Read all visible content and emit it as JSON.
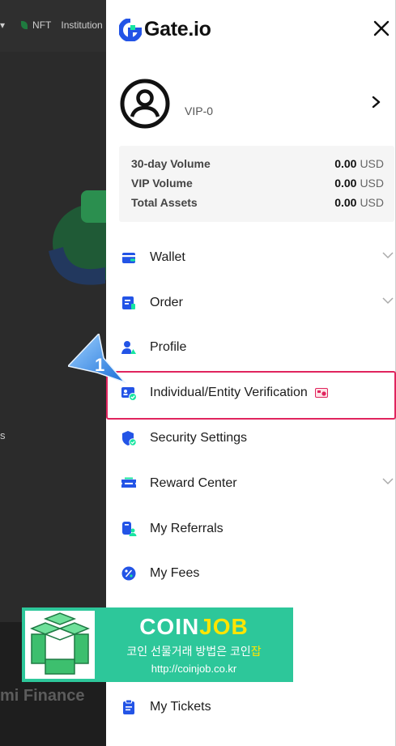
{
  "background_page": {
    "nav_arrow": "▾",
    "nav_nft": "NFT",
    "nav_institution": "Institution",
    "side_text": "s",
    "bottom_text": "mi Finance"
  },
  "header": {
    "brand": "Gate.io",
    "close_icon": "close-icon"
  },
  "profile": {
    "vip_label": "VIP-0"
  },
  "stats": [
    {
      "label": "30-day Volume",
      "value": "0.00",
      "unit": "USD"
    },
    {
      "label": "VIP Volume",
      "value": "0.00",
      "unit": "USD"
    },
    {
      "label": "Total Assets",
      "value": "0.00",
      "unit": "USD"
    }
  ],
  "menu": [
    {
      "label": "Wallet",
      "icon": "wallet-icon",
      "expandable": true
    },
    {
      "label": "Order",
      "icon": "order-icon",
      "expandable": true
    },
    {
      "label": "Profile",
      "icon": "profile-icon",
      "expandable": false
    },
    {
      "label": "Individual/Entity Verification",
      "icon": "verification-icon",
      "expandable": false,
      "badge": "id-card-badge-icon"
    },
    {
      "label": "Security Settings",
      "icon": "shield-icon",
      "expandable": false
    },
    {
      "label": "Reward Center",
      "icon": "ticket-icon",
      "expandable": true
    },
    {
      "label": "My Referrals",
      "icon": "referral-icon",
      "expandable": false
    },
    {
      "label": "My Fees",
      "icon": "percent-icon",
      "expandable": false
    },
    {
      "label": "My Tickets",
      "icon": "clipboard-icon",
      "expandable": false
    }
  ],
  "annotation": {
    "step_number": "1"
  },
  "banner": {
    "title_white": "COIN",
    "title_yellow": "JOB",
    "subtitle_white": "코인 선물거래 방법은 코인",
    "subtitle_yellow": "잡",
    "url": "http://coinjob.co.kr"
  },
  "colors": {
    "brand_blue": "#2354e6",
    "brand_green": "#17e5a1",
    "highlight_border": "#e0245e",
    "banner_green": "#2dc79a",
    "banner_yellow": "#ffe500"
  }
}
